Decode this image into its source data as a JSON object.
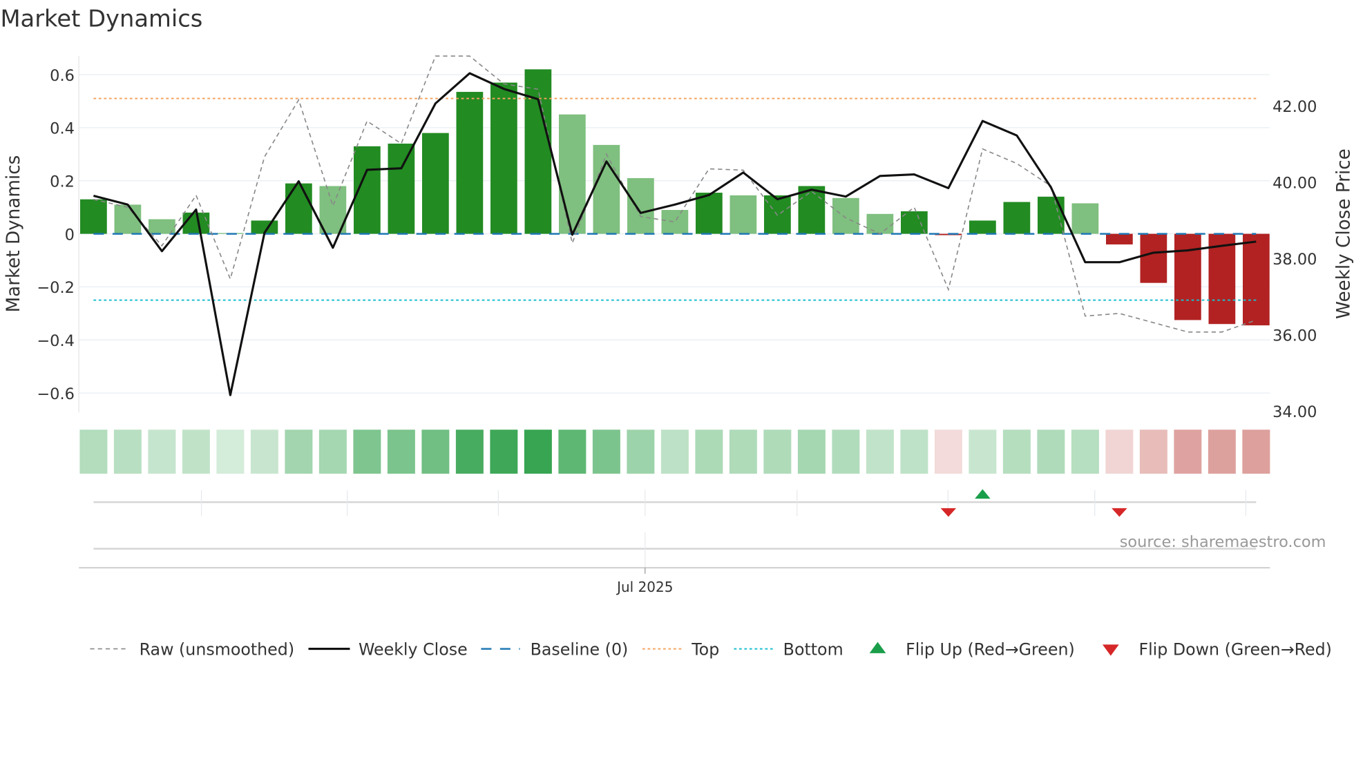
{
  "title": "Market Dynamics",
  "source": "source: sharemaestro.com",
  "chart_data": {
    "type": "bar",
    "title": "Market Dynamics",
    "ylabel": "Market Dynamics",
    "y2label": "Weekly Close Price",
    "ylim": [
      -0.67,
      0.67
    ],
    "y2lim": [
      34.0,
      43.6
    ],
    "yticks": [
      0.6,
      0.4,
      0.2,
      0,
      -0.2,
      -0.4,
      -0.6
    ],
    "ytick_labels": [
      "0.6",
      "0.4",
      "0.2",
      "0",
      "−0.2",
      "−0.4",
      "−0.6"
    ],
    "y2ticks": [
      42,
      40,
      38,
      36,
      34
    ],
    "y2tick_labels": [
      "42.00",
      "40.00",
      "38.00",
      "36.00",
      "34.00"
    ],
    "xtick_label": "Jul 2025",
    "xtick_index": 16,
    "grid": true,
    "top_level": 0.51,
    "bottom_level": -0.25,
    "colors": {
      "strong_green": "#228b22",
      "weak_green": "#7fbf7f",
      "red": "#b22222",
      "top": "#f4a460",
      "bottom": "#17becf",
      "baseline": "#1f77b4",
      "flip_up": "#1a9e4a",
      "flip_down": "#d62728"
    },
    "bars": [
      0.13,
      0.11,
      0.055,
      0.08,
      0.003,
      0.05,
      0.19,
      0.18,
      0.33,
      0.34,
      0.38,
      0.535,
      0.57,
      0.62,
      0.45,
      0.335,
      0.21,
      0.09,
      0.155,
      0.145,
      0.145,
      0.18,
      0.135,
      0.075,
      0.085,
      -0.005,
      0.05,
      0.12,
      0.14,
      0.115,
      -0.04,
      -0.185,
      -0.325,
      -0.34,
      -0.345
    ],
    "bar_strength": [
      "strong",
      "weak",
      "weak",
      "strong",
      "weak",
      "strong",
      "strong",
      "weak",
      "strong",
      "strong",
      "strong",
      "strong",
      "strong",
      "strong",
      "weak",
      "weak",
      "weak",
      "weak",
      "strong",
      "weak",
      "strong",
      "strong",
      "weak",
      "weak",
      "strong",
      "red",
      "strong",
      "strong",
      "strong",
      "weak",
      "red",
      "red",
      "red",
      "red",
      "red"
    ],
    "raw": [
      0.13,
      0.1,
      -0.045,
      0.145,
      -0.17,
      0.29,
      0.505,
      0.105,
      0.425,
      0.34,
      0.75,
      0.8,
      0.565,
      0.545,
      -0.035,
      0.3,
      0.065,
      0.045,
      0.245,
      0.24,
      0.07,
      0.16,
      0.06,
      0.0,
      0.1,
      -0.21,
      0.32,
      0.265,
      0.18,
      -0.31,
      -0.3,
      -0.335,
      -0.37,
      -0.37,
      -0.325
    ],
    "weekly_close": [
      39.64,
      39.41,
      38.19,
      39.28,
      34.42,
      38.67,
      40.02,
      38.28,
      40.32,
      40.36,
      42.06,
      42.85,
      42.44,
      42.17,
      38.62,
      40.54,
      39.19,
      39.41,
      39.66,
      40.25,
      39.55,
      39.8,
      39.62,
      40.16,
      40.2,
      39.84,
      41.6,
      41.22,
      39.86,
      37.9,
      37.9,
      38.15,
      38.21,
      38.33,
      38.44
    ],
    "flips": [
      {
        "index": 25,
        "type": "down"
      },
      {
        "index": 26,
        "type": "up"
      },
      {
        "index": 30,
        "type": "down"
      }
    ],
    "legend": {
      "placement": "bottom",
      "items": [
        {
          "label": "Raw (unsmoothed)",
          "style": "raw"
        },
        {
          "label": "Weekly Close",
          "style": "close"
        },
        {
          "label": "Baseline (0)",
          "style": "baseline"
        },
        {
          "label": "Top",
          "style": "top"
        },
        {
          "label": "Bottom",
          "style": "bottom"
        },
        {
          "label": "Flip Up (Red→Green)",
          "style": "up"
        },
        {
          "label": "Flip Down (Green→Red)",
          "style": "down"
        }
      ]
    }
  }
}
